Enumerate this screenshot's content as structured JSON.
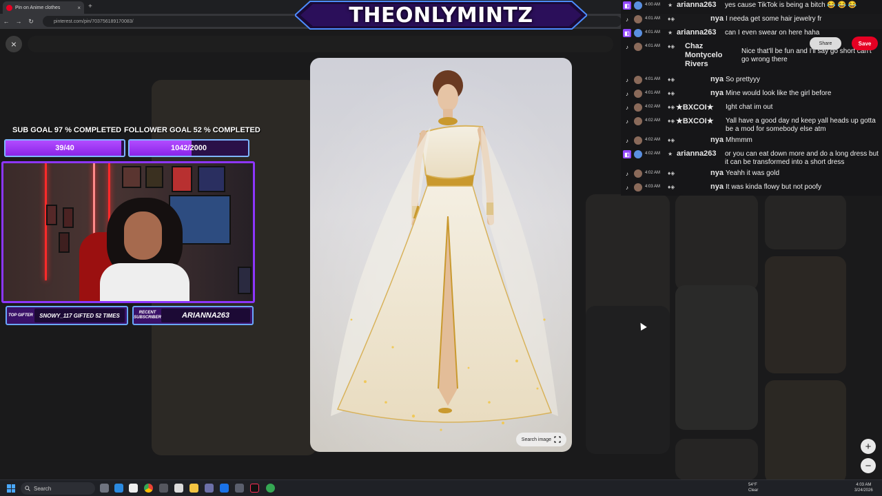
{
  "browser": {
    "tab_title": "Pin on Anime clothes",
    "tab_close": "×",
    "new_tab": "+",
    "url": "pinterest.com/pin/703756189170083/",
    "back": "←",
    "forward": "→",
    "reload": "↻"
  },
  "banner": {
    "title": "THEONLYMINTZ"
  },
  "goals": {
    "sub_label": "SUB GOAL 97 % COMPLETED",
    "sub_value": "39/40",
    "sub_progress": 0.975,
    "follower_label": "FOLLOWER GOAL 52 % COMPLETED",
    "follower_value": "1042/2000",
    "follower_progress": 0.521
  },
  "overlay_boxes": {
    "top_gifter_tag": "TOP GIFTER",
    "top_gifter_value": "SNOWY_117 GIFTED 52 TIMES",
    "recent_sub_tag": "RECENT SUBSCRIBER",
    "recent_sub_value": "ARIANNA263"
  },
  "pin": {
    "close": "×",
    "search_image": "Search image",
    "share": "Share",
    "save": "Save",
    "zoom_in": "+",
    "zoom_out": "−"
  },
  "chat": [
    {
      "platform": "twitch",
      "time": "4:00 AM",
      "user": "arianna263",
      "msg": "yes cause TikTok is being a bitch 😂 😂 😂"
    },
    {
      "platform": "tiktok",
      "time": "4:01 AM",
      "user": "nya",
      "msg": "I needa get some hair jewelry fr"
    },
    {
      "platform": "twitch",
      "time": "4:01 AM",
      "user": "arianna263",
      "msg": "can I even swear on here haha"
    },
    {
      "platform": "tiktok",
      "time": "4:01 AM",
      "user": "Chaz Montycelo Rivers",
      "msg": "Nice that'll be fun and I'll say go short can't go wrong there"
    },
    {
      "platform": "tiktok",
      "time": "4:01 AM",
      "user": "nya",
      "msg": "So prettyyy"
    },
    {
      "platform": "tiktok",
      "time": "4:01 AM",
      "user": "nya",
      "msg": "Mine would look like the girl before"
    },
    {
      "platform": "tiktok",
      "time": "4:02 AM",
      "user": "★BXCOI★",
      "msg": "Ight chat im out"
    },
    {
      "platform": "tiktok",
      "time": "4:02 AM",
      "user": "★BXCOI★",
      "msg": "Yall have a good day nd keep yall heads up gotta be a mod for somebody else atm"
    },
    {
      "platform": "tiktok",
      "time": "4:02 AM",
      "user": "nya",
      "msg": "Mhmmm"
    },
    {
      "platform": "twitch",
      "time": "4:02 AM",
      "user": "arianna263",
      "msg": "or you can eat down more and do a long dress but it can be transformed into a short dress"
    },
    {
      "platform": "tiktok",
      "time": "4:02 AM",
      "user": "nya",
      "msg": "Yeahh it was gold"
    },
    {
      "platform": "tiktok",
      "time": "4:03 AM",
      "user": "nya",
      "msg": "It was kinda flowy but not poofy"
    }
  ],
  "taskbar": {
    "search": "Search",
    "weather_temp": "54°F",
    "weather_cond": "Clear",
    "time": "4:03 AM",
    "date": "3/24/2026"
  }
}
